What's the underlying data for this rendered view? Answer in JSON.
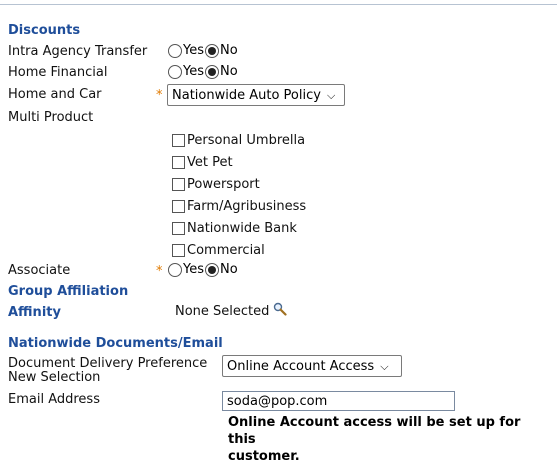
{
  "sections": {
    "discounts": "Discounts",
    "group_affiliation": "Group Affiliation",
    "documents": "Nationwide Documents/Email"
  },
  "discounts": {
    "intra_agency": {
      "label": "Intra Agency Transfer",
      "yes": "Yes",
      "no": "No",
      "selected": "No"
    },
    "home_financial": {
      "label": "Home Financial",
      "yes": "Yes",
      "no": "No",
      "selected": "No"
    },
    "home_and_car": {
      "label": "Home and Car",
      "required": "*",
      "value": "Nationwide Auto Policy"
    },
    "multi_product": {
      "label": "Multi Product",
      "options": [
        "Personal Umbrella",
        "Vet Pet",
        "Powersport",
        "Farm/Agribusiness",
        "Nationwide Bank",
        "Commercial"
      ]
    },
    "associate": {
      "label": "Associate",
      "required": "*",
      "yes": "Yes",
      "no": "No",
      "selected": "No"
    }
  },
  "affinity": {
    "label": "Affinity",
    "value": "None Selected",
    "icon": "magnifier-icon"
  },
  "documents": {
    "delivery_label_line1": "Document Delivery Preference",
    "delivery_label_line2": "New Selection",
    "delivery_value": "Online Account Access",
    "email_label": "Email Address",
    "email_value": "soda@pop.com",
    "note_line1": "Online Account access will be set up for this",
    "note_line2": "customer."
  },
  "colors": {
    "section_heading": "#1f4e9a",
    "required_marker": "#e07a00"
  }
}
